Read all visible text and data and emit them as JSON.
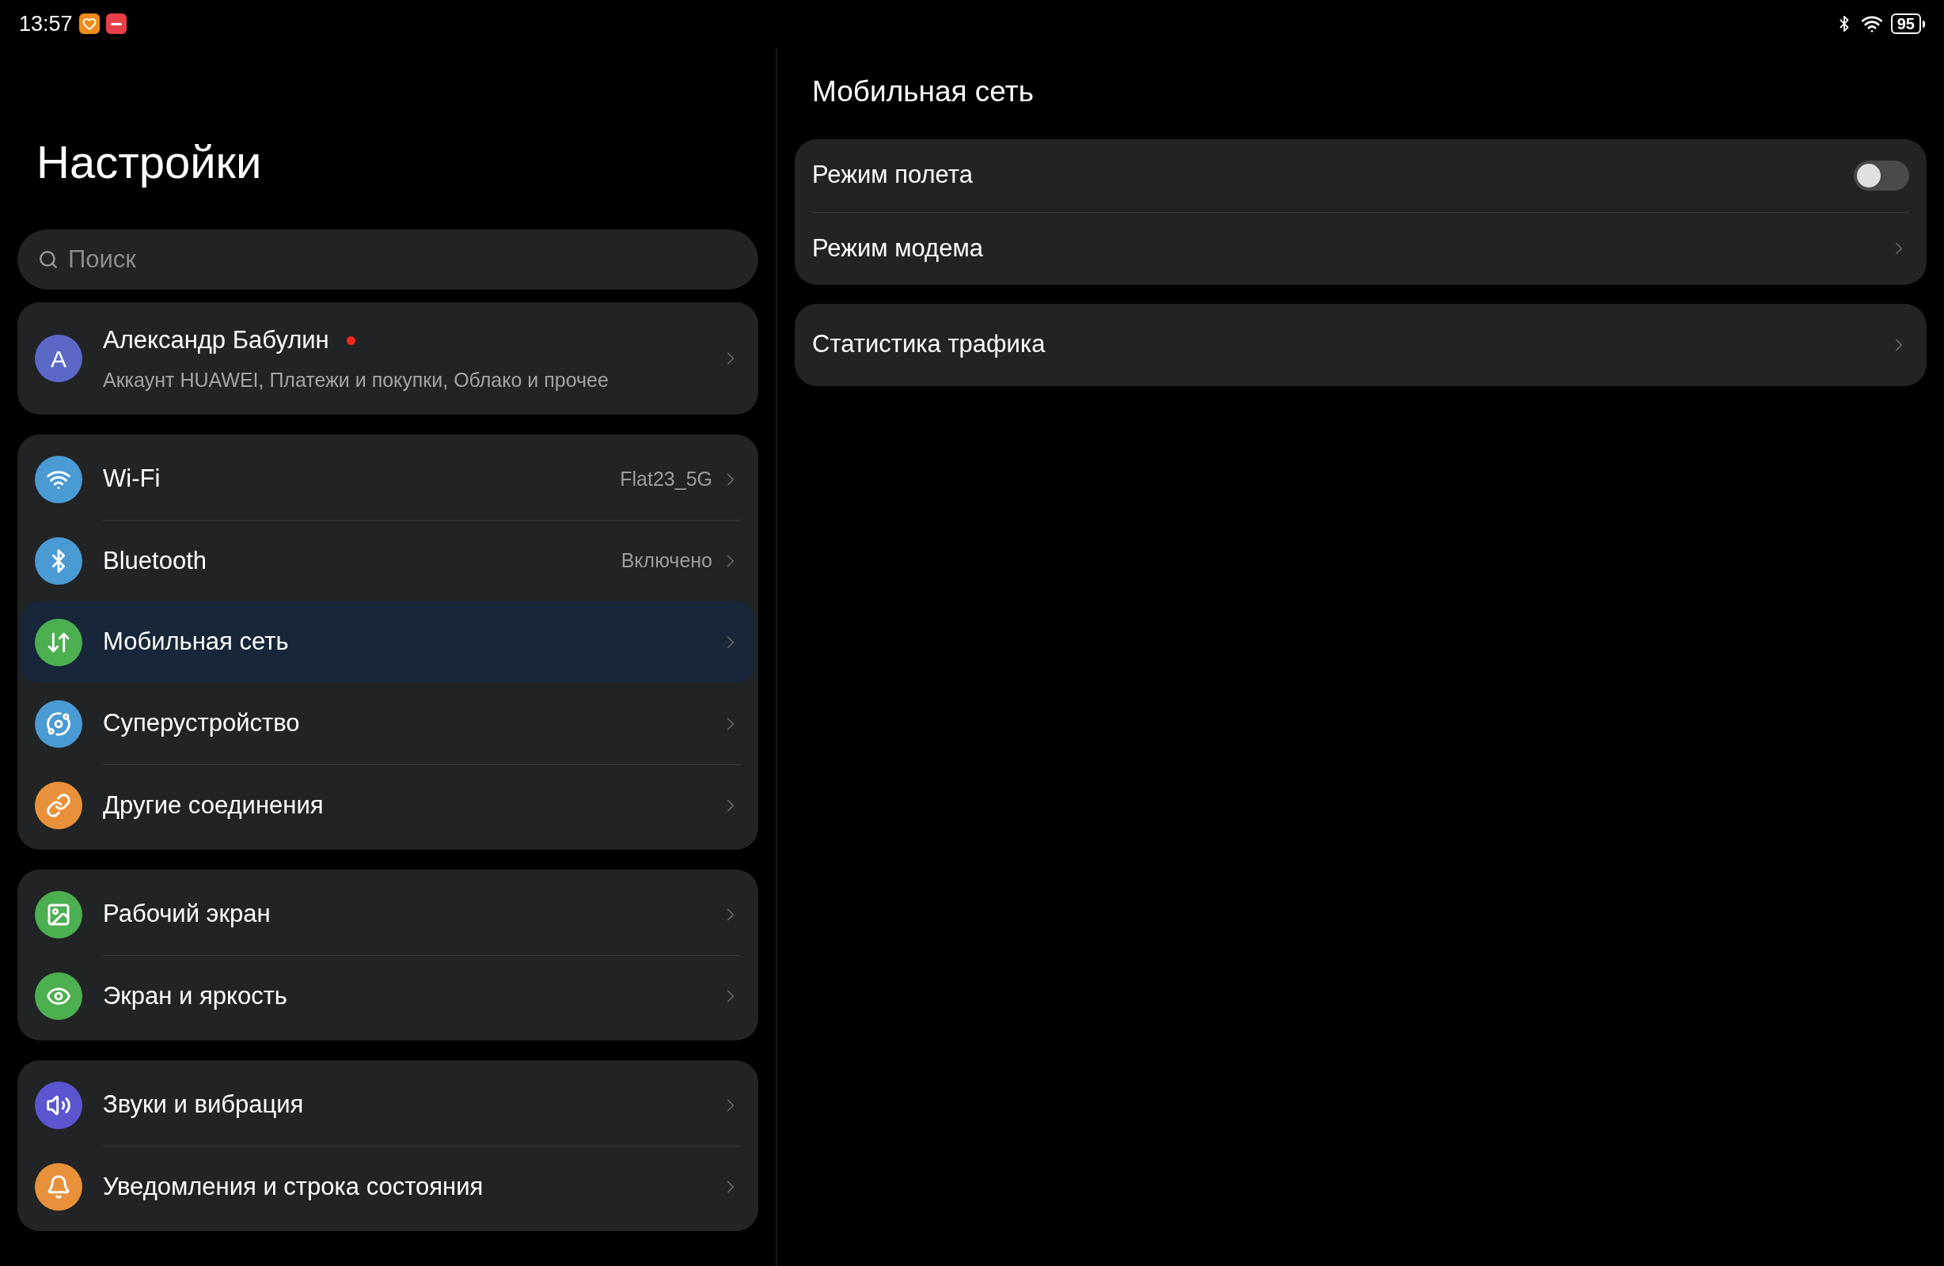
{
  "status_bar": {
    "time": "13:57",
    "battery": "95"
  },
  "sidebar": {
    "title": "Настройки",
    "search": {
      "placeholder": "Поиск"
    },
    "account": {
      "initial": "А",
      "name": "Александр Бабулин",
      "notification": true,
      "subtitle": "Аккаунт HUAWEI, Платежи и покупки, Облако и прочее"
    },
    "groups": [
      {
        "items": [
          {
            "label": "Wi-Fi",
            "value": "Flat23_5G",
            "color": "#4a9ad4",
            "selected": false
          },
          {
            "label": "Bluetooth",
            "value": "Включено",
            "color": "#4a9ad4",
            "selected": false
          },
          {
            "label": "Мобильная сеть",
            "color": "#4caf50",
            "selected": true
          },
          {
            "label": "Суперустройство",
            "color": "#4a9ad4",
            "selected": false
          },
          {
            "label": "Другие соединения",
            "color": "#e8913a",
            "selected": false
          }
        ]
      },
      {
        "items": [
          {
            "label": "Рабочий экран",
            "color": "#4caf50",
            "selected": false
          },
          {
            "label": "Экран и яркость",
            "color": "#4caf50",
            "selected": false
          }
        ]
      },
      {
        "items": [
          {
            "label": "Звуки и вибрация",
            "color": "#5b55cf",
            "selected": false
          },
          {
            "label": "Уведомления и строка состояния",
            "color": "#e8913a",
            "selected": false
          }
        ]
      }
    ]
  },
  "detail": {
    "title": "Мобильная сеть",
    "cards": [
      {
        "rows": [
          {
            "kind": "toggle",
            "label": "Режим полета",
            "on": false
          },
          {
            "kind": "link",
            "label": "Режим модема"
          }
        ]
      },
      {
        "rows": [
          {
            "kind": "link",
            "label": "Статистика трафика"
          }
        ]
      }
    ]
  }
}
